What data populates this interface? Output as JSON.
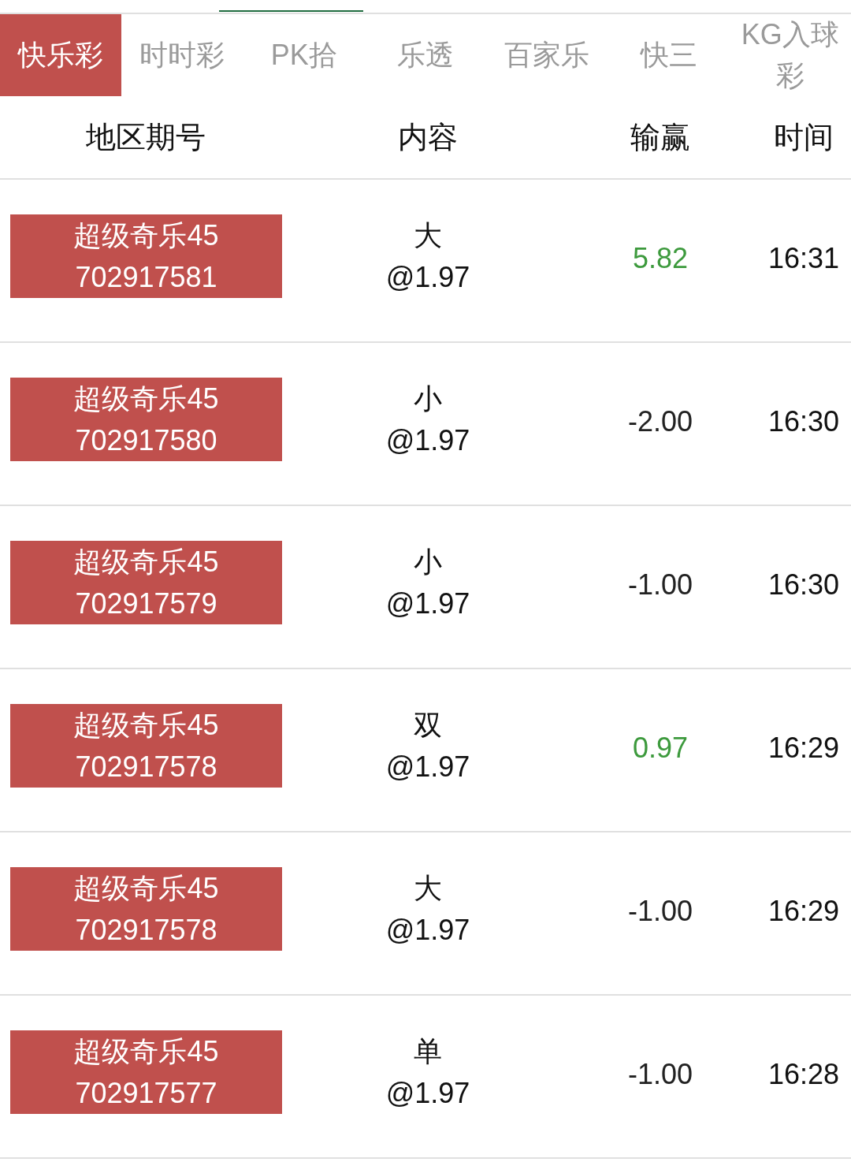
{
  "tabs": [
    {
      "label": "快乐彩",
      "selected": true
    },
    {
      "label": "时时彩",
      "selected": false
    },
    {
      "label": "PK拾",
      "selected": false
    },
    {
      "label": "乐透",
      "selected": false
    },
    {
      "label": "百家乐",
      "selected": false
    },
    {
      "label": "快三",
      "selected": false
    },
    {
      "label": "KG入球彩",
      "selected": false
    }
  ],
  "table": {
    "columns": [
      "地区期号",
      "内容",
      "输赢",
      "时间"
    ],
    "rows": [
      {
        "region": "超级奇乐45",
        "period": "702917581",
        "content": "大",
        "odds": "@1.97",
        "result": "5.82",
        "color": "#3d9a3d",
        "time": "16:31"
      },
      {
        "region": "超级奇乐45",
        "period": "702917580",
        "content": "小",
        "odds": "@1.97",
        "result": "-2.00",
        "color": "#222222",
        "time": "16:30"
      },
      {
        "region": "超级奇乐45",
        "period": "702917579",
        "content": "小",
        "odds": "@1.97",
        "result": "-1.00",
        "color": "#222222",
        "time": "16:30"
      },
      {
        "region": "超级奇乐45",
        "period": "702917578",
        "content": "双",
        "odds": "@1.97",
        "result": "0.97",
        "color": "#3d9a3d",
        "time": "16:29"
      },
      {
        "region": "超级奇乐45",
        "period": "702917578",
        "content": "大",
        "odds": "@1.97",
        "result": "-1.00",
        "color": "#222222",
        "time": "16:29"
      },
      {
        "region": "超级奇乐45",
        "period": "702917577",
        "content": "单",
        "odds": "@1.97",
        "result": "-1.00",
        "color": "#222222",
        "time": "16:28"
      }
    ]
  }
}
